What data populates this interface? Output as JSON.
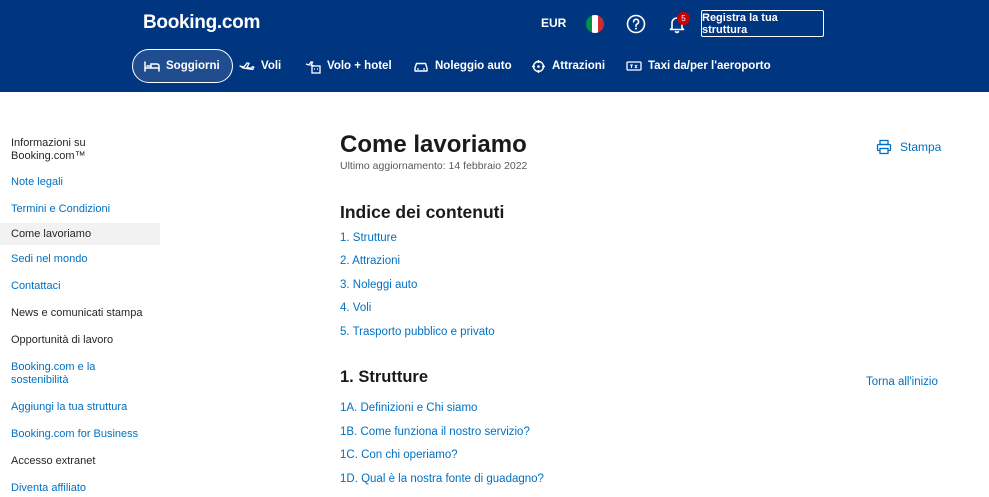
{
  "header": {
    "logo": "Booking.com",
    "currency": "EUR",
    "notifications_count": "5",
    "register_label": "Registra la tua struttura",
    "flag_colors": [
      "#009246",
      "#ffffff",
      "#ce2b37"
    ]
  },
  "nav": {
    "items": [
      {
        "label": "Soggiorni",
        "icon": "bed-icon",
        "active": true
      },
      {
        "label": "Voli",
        "icon": "plane-icon"
      },
      {
        "label": "Volo + hotel",
        "icon": "plane-hotel-icon"
      },
      {
        "label": "Noleggio auto",
        "icon": "car-icon"
      },
      {
        "label": "Attrazioni",
        "icon": "attractions-icon"
      },
      {
        "label": "Taxi da/per l'aeroporto",
        "icon": "taxi-icon"
      }
    ]
  },
  "sidebar": {
    "items": [
      {
        "label": "Informazioni su Booking.com™",
        "style": "dark"
      },
      {
        "label": "Note legali",
        "style": "link"
      },
      {
        "label": "Termini e Condizioni",
        "style": "link"
      },
      {
        "label": "Come lavoriamo",
        "style": "active"
      },
      {
        "label": "Sedi nel mondo",
        "style": "link"
      },
      {
        "label": "Contattaci",
        "style": "link"
      },
      {
        "label": "News e comunicati stampa",
        "style": "dark"
      },
      {
        "label": "Opportunità di lavoro",
        "style": "dark"
      },
      {
        "label": "Booking.com e la sostenibilità",
        "style": "link"
      },
      {
        "label": "Aggiungi la tua struttura",
        "style": "link"
      },
      {
        "label": "Booking.com for Business",
        "style": "link"
      },
      {
        "label": "Accesso extranet",
        "style": "dark"
      },
      {
        "label": "Diventa affiliato",
        "style": "link"
      }
    ]
  },
  "main": {
    "title": "Come lavoriamo",
    "updated": "Ultimo aggiornamento: 14 febbraio 2022",
    "print_label": "Stampa",
    "toc_title": "Indice dei contenuti",
    "toc": [
      "1. Strutture",
      "2. Attrazioni",
      "3. Noleggi auto",
      "4. Voli",
      "5. Trasporto pubblico e privato"
    ],
    "section_title": "1. Strutture",
    "back_to_top": "Torna all'inizio",
    "subsections": [
      "1A. Definizioni e Chi siamo",
      "1B. Come funziona il nostro servizio?",
      "1C. Con chi operiamo?",
      "1D. Qual è la nostra fonte di guadagno?"
    ]
  },
  "colors": {
    "brand": "#003580",
    "link": "#0071c2",
    "badge": "#cc0000"
  }
}
